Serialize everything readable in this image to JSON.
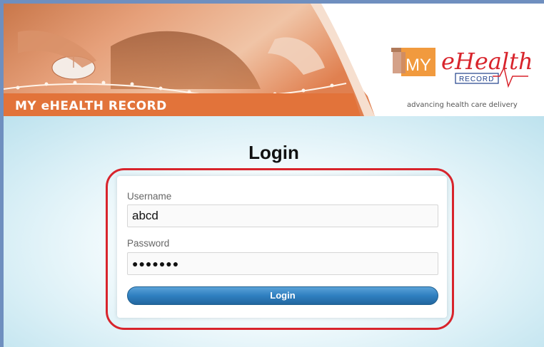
{
  "header": {
    "banner_title": "MY eHEALTH RECORD",
    "logo": {
      "my": "MY",
      "ehealth": "eHealth",
      "record": "RECORD",
      "tagline": "advancing health care delivery"
    }
  },
  "main": {
    "title": "Login",
    "username": {
      "label": "Username",
      "value": "abcd"
    },
    "password": {
      "label": "Password",
      "value": "●●●●●●●"
    },
    "login_button": "Login"
  },
  "colors": {
    "banner_orange": "#e2733a",
    "highlight_red": "#d8242c",
    "button_blue": "#2f7fc0",
    "frame_blue": "#6f8fbf"
  }
}
